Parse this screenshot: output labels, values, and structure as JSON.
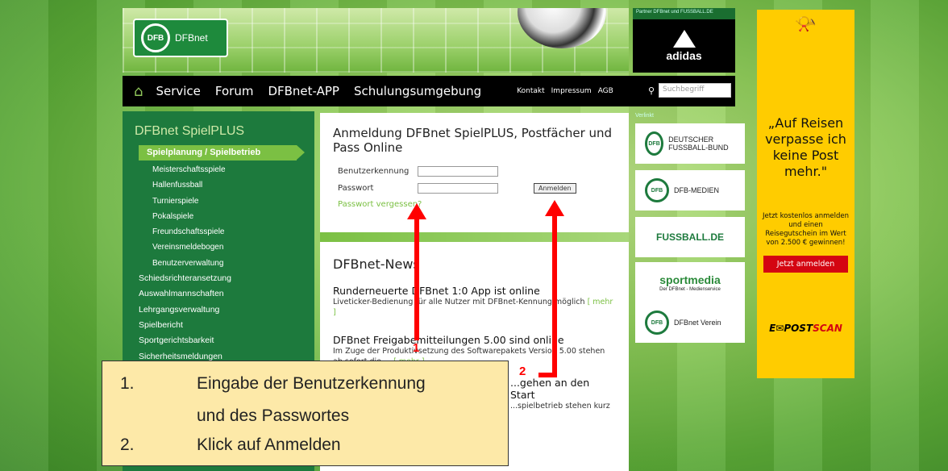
{
  "header": {
    "logo_text": "DFBnet",
    "partner_label": "Partner DFBnet und FUSSBALL.DE",
    "partner_brand": "adidas"
  },
  "nav": {
    "items": [
      "Service",
      "Forum",
      "DFBnet-APP",
      "Schulungsumgebung"
    ],
    "small_links": [
      "Kontakt",
      "Impressum",
      "AGB"
    ],
    "search_placeholder": "Suchbegriff"
  },
  "sidebar": {
    "title": "DFBnet SpielPLUS",
    "active": "Spielplanung / Spielbetrieb",
    "sub_items": [
      "Meisterschaftsspiele",
      "Hallenfussball",
      "Turnierspiele",
      "Pokalspiele",
      "Freundschaftsspiele",
      "Vereinsmeldebogen",
      "Benutzerverwaltung"
    ],
    "top_items": [
      "Schiedsrichteransetzung",
      "Auswahlmannschaften",
      "Lehrgangsverwaltung",
      "Spielbericht",
      "Sportgerichtsbarkeit",
      "Sicherheitsmeldungen"
    ]
  },
  "login": {
    "title": "Anmeldung DFBnet SpielPLUS, Postfächer und Pass Online",
    "user_label": "Benutzerkennung",
    "pass_label": "Passwort",
    "button": "Anmelden",
    "forgot": "Passwort vergessen?"
  },
  "news": {
    "heading": "DFBnet-News",
    "items": [
      {
        "title": "Runderneuerte DFBnet 1:0 App ist online",
        "text": "Liveticker-Bedienung für alle Nutzer mit DFBnet-Kennung möglich",
        "more": "[ mehr ]"
      },
      {
        "title": "DFBnet Freigabemitteilungen 5.00 sind online",
        "text": "Im Zuge der Produktivsetzung des Softwarepakets Version 5.00 stehen ab sofort die ...",
        "more": "[ mehr ]"
      },
      {
        "title": "...gehen an den Start",
        "text": "...spielbetrieb stehen kurz"
      }
    ]
  },
  "right_links": {
    "label": "Verlinkt",
    "items": [
      "DEUTSCHER FUSSBALL-BUND",
      "DFB-MEDIEN",
      "FUSSBALL.DE",
      "sportmedia",
      "DFBnet Verein"
    ],
    "sportmedia_sub": "Der DFBnet - Medienservice"
  },
  "ad": {
    "quote": "„Auf Reisen verpasse ich keine Post mehr.\"",
    "text": "Jetzt kostenlos anmelden und einen Reisegutschein im Wert von 2.500 € gewinnen!",
    "cta": "Jetzt anmelden",
    "brand_prefix": "E✉POST",
    "brand_suffix": "SCAN"
  },
  "annotation": {
    "num1": "1",
    "num2": "2",
    "line1_num": "1.",
    "line1_text": "Eingabe der Benutzerkennung",
    "line1_cont": "und des Passwortes",
    "line2_num": "2.",
    "line2_text": "Klick auf Anmelden"
  },
  "colors": {
    "dfb_green": "#1d7a3d",
    "accent_green": "#7bc043",
    "arrow_red": "#ff0000",
    "ad_yellow": "#ffcc00"
  }
}
